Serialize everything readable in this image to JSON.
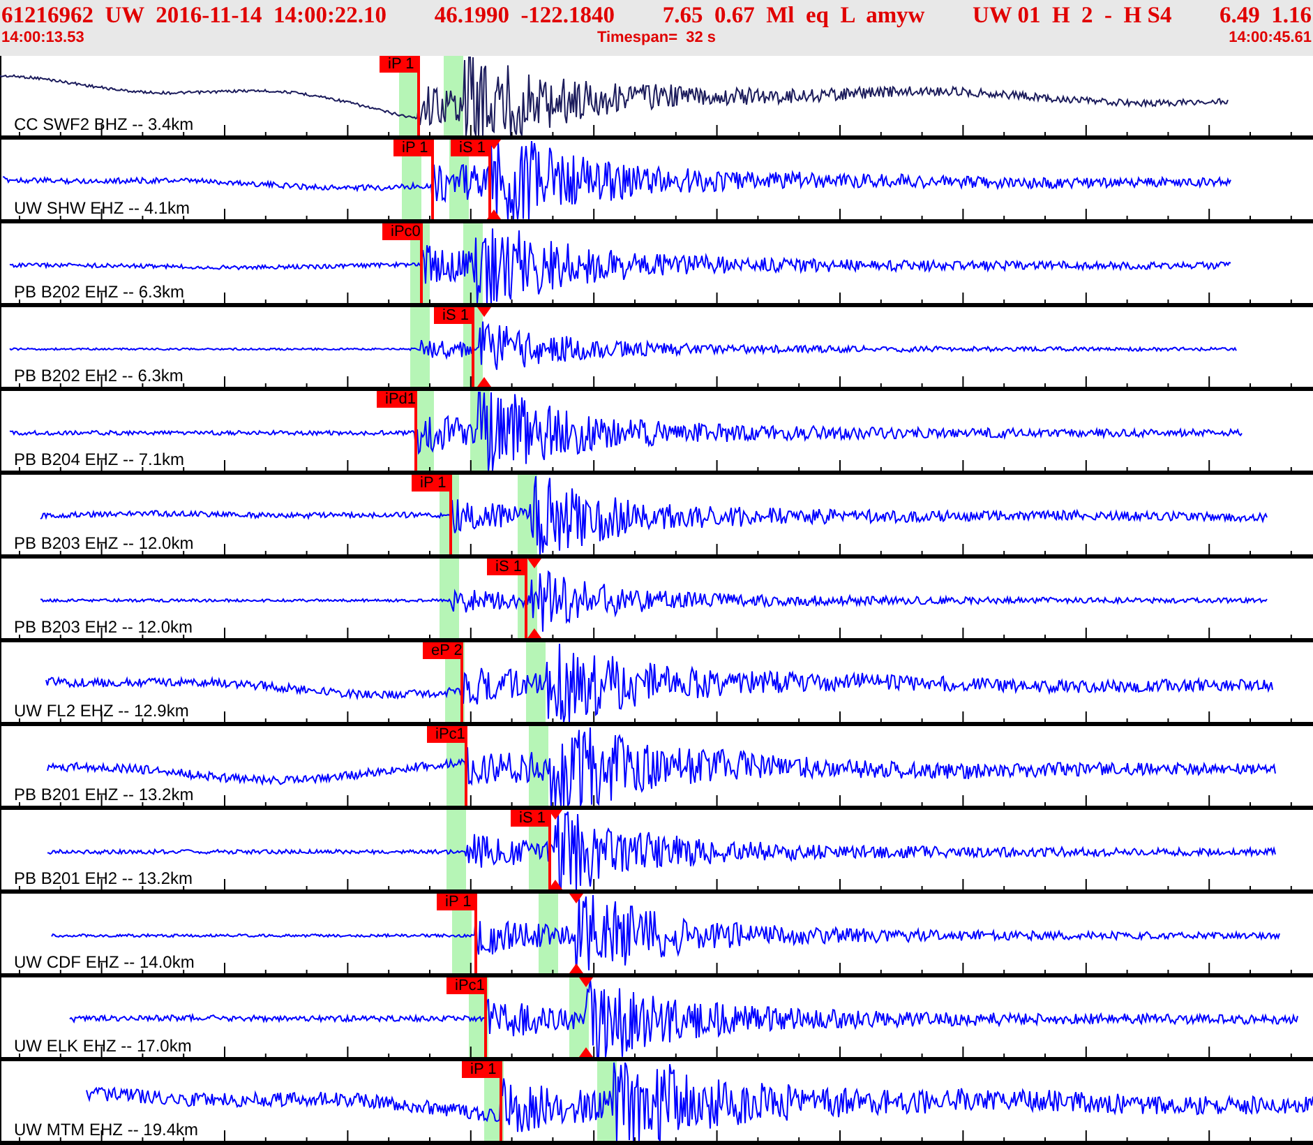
{
  "header": {
    "fields": [
      "61216962  UW  2016-11-14  14:00:22.10",
      "46.1990  -122.1840",
      "7.65  0.67  Ml  eq  L  amyw",
      "UW 01  H  2  -  H S4",
      "6.49  1.16"
    ],
    "start_time": "14:00:13.53",
    "timespan": "Timespan=  32 s",
    "end_time": "14:00:45.61"
  },
  "traces": [
    {
      "label": "CC SWF2 BHZ -- 3.4km",
      "color": "#1c1c5c",
      "picks": [
        {
          "label": "iP 1"
        }
      ]
    },
    {
      "label": "UW SHW EHZ -- 4.1km",
      "color": "#0000ff",
      "picks": [
        {
          "label": "iP 1"
        },
        {
          "label": "iS 1"
        }
      ]
    },
    {
      "label": "PB B202 EHZ -- 6.3km",
      "color": "#0000ff",
      "picks": [
        {
          "label": "iPc0"
        }
      ]
    },
    {
      "label": "PB B202 EH2 -- 6.3km",
      "color": "#0000ff",
      "picks": [
        {
          "label": "iS 1"
        }
      ]
    },
    {
      "label": "PB B204 EHZ -- 7.1km",
      "color": "#0000ff",
      "picks": [
        {
          "label": "iPd1"
        }
      ]
    },
    {
      "label": "PB B203 EHZ -- 12.0km",
      "color": "#0000ff",
      "picks": [
        {
          "label": "iP 1"
        }
      ]
    },
    {
      "label": "PB B203 EH2 -- 12.0km",
      "color": "#0000ff",
      "picks": [
        {
          "label": "iS 1"
        }
      ]
    },
    {
      "label": "UW FL2 EHZ -- 12.9km",
      "color": "#0000ff",
      "picks": [
        {
          "label": "eP 2"
        }
      ]
    },
    {
      "label": "PB B201 EHZ -- 13.2km",
      "color": "#0000ff",
      "picks": [
        {
          "label": "iPc1"
        }
      ]
    },
    {
      "label": "PB B201 EH2 -- 13.2km",
      "color": "#0000ff",
      "picks": [
        {
          "label": "iS 1"
        }
      ]
    },
    {
      "label": "UW CDF EHZ -- 14.0km",
      "color": "#0000ff",
      "picks": [
        {
          "label": "iP 1"
        }
      ]
    },
    {
      "label": "UW ELK EHZ -- 17.0km",
      "color": "#0000ff",
      "picks": [
        {
          "label": "iPc1"
        }
      ]
    },
    {
      "label": "UW MTM EHZ -- 19.4km",
      "color": "#0000ff",
      "picks": [
        {
          "label": "iP 1"
        }
      ]
    }
  ]
}
